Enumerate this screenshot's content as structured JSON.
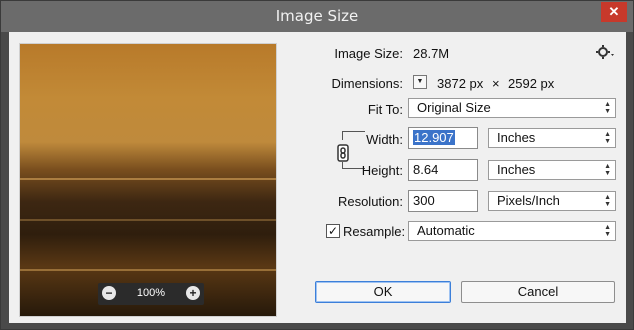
{
  "window": {
    "title": "Image Size",
    "close_symbol": "✕"
  },
  "preview": {
    "zoom_value": "100%",
    "zoom_out_symbol": "−",
    "zoom_in_symbol": "+"
  },
  "image_size": {
    "label": "Image Size:",
    "value": "28.7M"
  },
  "dimensions": {
    "label": "Dimensions:",
    "width_px": "3872 px",
    "times": "×",
    "height_px": "2592 px"
  },
  "fit_to": {
    "label": "Fit To:",
    "value": "Original Size"
  },
  "width": {
    "label": "Width:",
    "value": "12.907",
    "unit": "Inches"
  },
  "height": {
    "label": "Height:",
    "value": "8.64",
    "unit": "Inches"
  },
  "resolution": {
    "label": "Resolution:",
    "value": "300",
    "unit": "Pixels/Inch"
  },
  "resample": {
    "label": "Resample:",
    "checked": true,
    "check_symbol": "✓",
    "value": "Automatic"
  },
  "buttons": {
    "ok": "OK",
    "cancel": "Cancel"
  },
  "icons": {
    "settings": "gear-icon",
    "link": "chain-link-icon"
  },
  "colors": {
    "title_bar": "#6b6b6b",
    "close_button": "#c7392b",
    "selection": "#3b73c9",
    "dialog_bg": "#f0f0f0"
  }
}
